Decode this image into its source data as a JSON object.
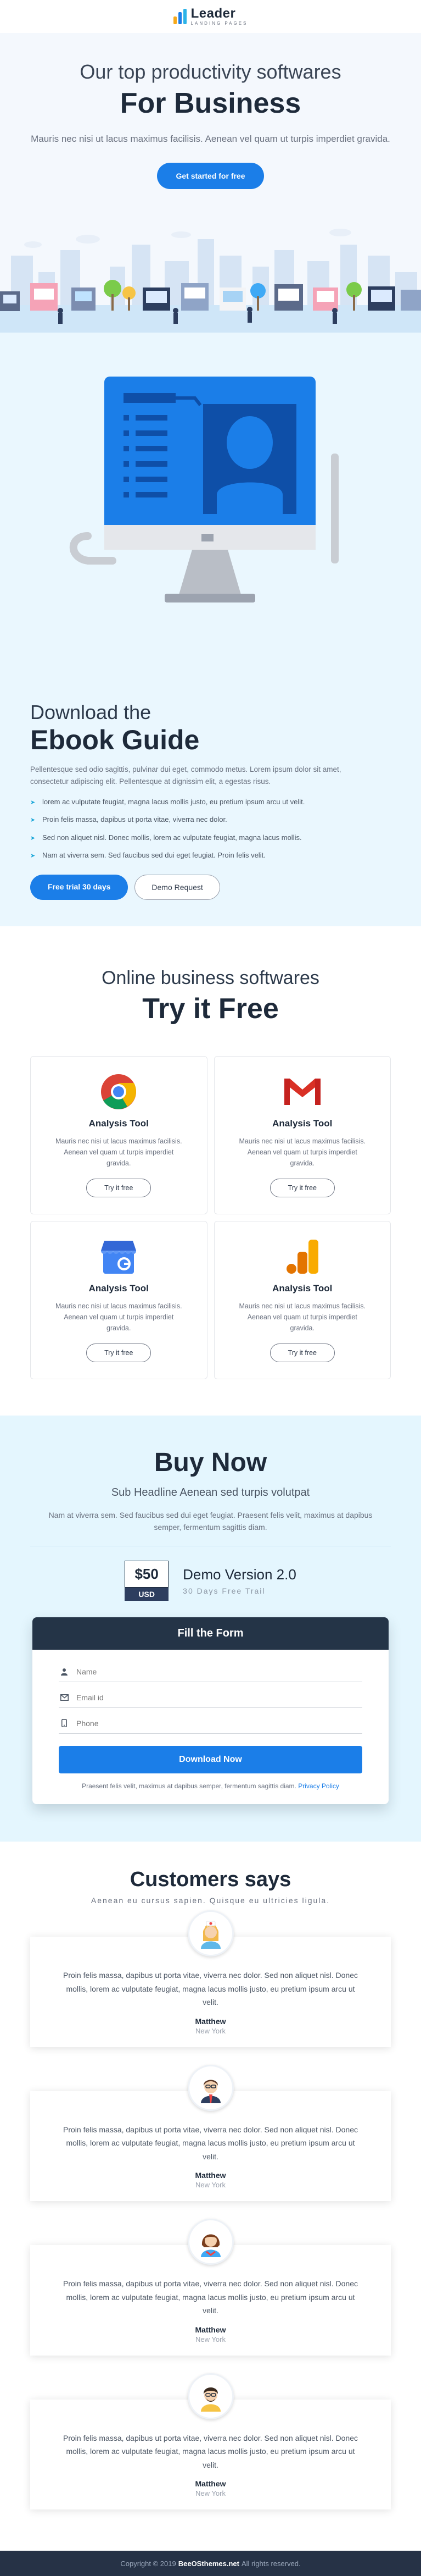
{
  "brand": {
    "name": "Leader",
    "tagline": "LANDING PAGES",
    "colors": {
      "primary": "#1b7ee8",
      "dark": "#1e2a3a",
      "hero_bg": "#f4f8fd",
      "light_blue_bg": "#eaf7fe",
      "footer_bg": "#263246"
    }
  },
  "hero": {
    "subtitle": "Our top productivity softwares",
    "title": "For Business",
    "description": "Mauris nec nisi ut lacus maximus facilisis. Aenean vel quam ut turpis imperdiet gravida.",
    "cta_label": "Get started for free"
  },
  "ebook": {
    "subtitle": "Download the",
    "title": "Ebook Guide",
    "description": "Pellentesque sed odio sagittis, pulvinar dui eget, commodo metus. Lorem ipsum dolor sit amet, consectetur adipiscing elit. Pellentesque at dignissim elit, a egestas risus.",
    "bullets": [
      "lorem ac vulputate feugiat, magna lacus mollis justo, eu pretium ipsum arcu ut velit.",
      "Proin felis massa, dapibus ut porta vitae, viverra nec dolor.",
      "Sed non aliquet nisl. Donec mollis, lorem ac vulputate feugiat, magna lacus mollis.",
      "Nam at viverra sem. Sed faucibus sed dui eget feugiat. Proin felis velit."
    ],
    "primary_label": "Free trial 30 days",
    "secondary_label": "Demo Request"
  },
  "tools": {
    "subtitle": "Online business softwares",
    "title": "Try it Free",
    "items": [
      {
        "icon": "chrome-icon",
        "title": "Analysis Tool",
        "text": "Mauris nec nisi ut lacus maximus facilisis. Aenean vel quam ut turpis imperdiet gravida.",
        "button": "Try it free"
      },
      {
        "icon": "gmail-icon",
        "title": "Analysis Tool",
        "text": "Mauris nec nisi ut lacus maximus facilisis. Aenean vel quam ut turpis imperdiet gravida.",
        "button": "Try it free"
      },
      {
        "icon": "google-my-business-icon",
        "title": "Analysis Tool",
        "text": "Mauris nec nisi ut lacus maximus facilisis. Aenean vel quam ut turpis imperdiet gravida.",
        "button": "Try it free"
      },
      {
        "icon": "google-analytics-icon",
        "title": "Analysis Tool",
        "text": "Mauris nec nisi ut lacus maximus facilisis. Aenean vel quam ut turpis imperdiet gravida.",
        "button": "Try it free"
      }
    ]
  },
  "buy": {
    "title": "Buy Now",
    "subtitle": "Sub Headline Aenean sed turpis volutpat",
    "description": "Nam at viverra sem. Sed faucibus sed dui eget feugiat. Praesent felis velit, maximus at dapibus semper, fermentum sagittis diam.",
    "price": "$50",
    "currency": "USD",
    "plan_name": "Demo Version 2.0",
    "plan_sub": "30 Days Free Trail",
    "form": {
      "title": "Fill the Form",
      "name_placeholder": "Name",
      "email_placeholder": "Email id",
      "phone_placeholder": "Phone",
      "submit_label": "Download Now",
      "note": "Praesent felis velit, maximus at dapibus semper, fermentum sagittis diam.",
      "privacy_label": "Privacy Policy"
    }
  },
  "testimonials": {
    "title": "Customers says",
    "subtitle": "Aenean eu cursus sapien. Quisque eu ultricies ligula.",
    "items": [
      {
        "avatar": "nurse-avatar-icon",
        "quote": "Proin felis massa, dapibus ut porta vitae, viverra nec dolor. Sed non aliquet nisl. Donec mollis, lorem ac vulputate feugiat, magna lacus mollis justo, eu pretium ipsum arcu ut velit.",
        "name": "Matthew",
        "location": "New York"
      },
      {
        "avatar": "office-man-avatar-icon",
        "quote": "Proin felis massa, dapibus ut porta vitae, viverra nec dolor. Sed non aliquet nisl. Donec mollis, lorem ac vulputate feugiat, magna lacus mollis justo, eu pretium ipsum arcu ut velit.",
        "name": "Matthew",
        "location": "New York"
      },
      {
        "avatar": "woman-avatar-icon",
        "quote": "Proin felis massa, dapibus ut porta vitae, viverra nec dolor. Sed non aliquet nisl. Donec mollis, lorem ac vulputate feugiat, magna lacus mollis justo, eu pretium ipsum arcu ut velit.",
        "name": "Matthew",
        "location": "New York"
      },
      {
        "avatar": "man-avatar-icon",
        "quote": "Proin felis massa, dapibus ut porta vitae, viverra nec dolor. Sed non aliquet nisl. Donec mollis, lorem ac vulputate feugiat, magna lacus mollis justo, eu pretium ipsum arcu ut velit.",
        "name": "Matthew",
        "location": "New York"
      }
    ]
  },
  "footer": {
    "copyright": "Copyright © 2019",
    "site": "BeeOSthemes.net",
    "rights": "All rights reserved."
  }
}
